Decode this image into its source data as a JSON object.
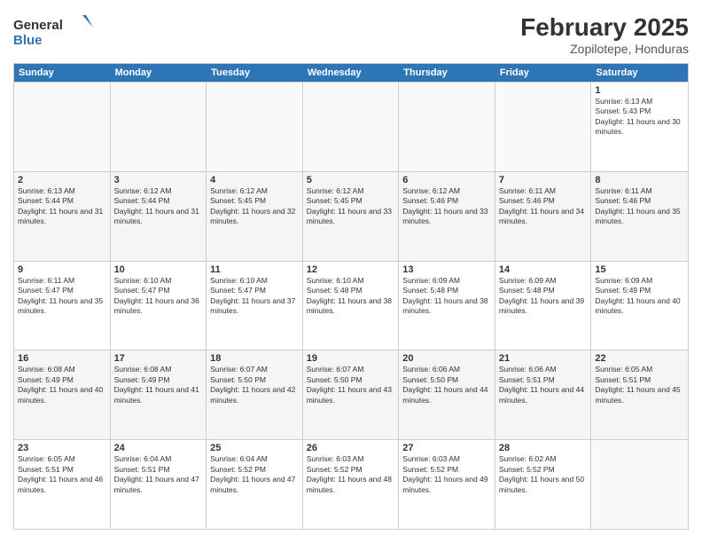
{
  "header": {
    "logo_general": "General",
    "logo_blue": "Blue",
    "month_year": "February 2025",
    "location": "Zopilotepe, Honduras"
  },
  "day_headers": [
    "Sunday",
    "Monday",
    "Tuesday",
    "Wednesday",
    "Thursday",
    "Friday",
    "Saturday"
  ],
  "weeks": [
    {
      "days": [
        {
          "num": "",
          "info": ""
        },
        {
          "num": "",
          "info": ""
        },
        {
          "num": "",
          "info": ""
        },
        {
          "num": "",
          "info": ""
        },
        {
          "num": "",
          "info": ""
        },
        {
          "num": "",
          "info": ""
        },
        {
          "num": "1",
          "info": "Sunrise: 6:13 AM\nSunset: 5:43 PM\nDaylight: 11 hours and 30 minutes."
        }
      ]
    },
    {
      "days": [
        {
          "num": "2",
          "info": "Sunrise: 6:13 AM\nSunset: 5:44 PM\nDaylight: 11 hours and 31 minutes."
        },
        {
          "num": "3",
          "info": "Sunrise: 6:12 AM\nSunset: 5:44 PM\nDaylight: 11 hours and 31 minutes."
        },
        {
          "num": "4",
          "info": "Sunrise: 6:12 AM\nSunset: 5:45 PM\nDaylight: 11 hours and 32 minutes."
        },
        {
          "num": "5",
          "info": "Sunrise: 6:12 AM\nSunset: 5:45 PM\nDaylight: 11 hours and 33 minutes."
        },
        {
          "num": "6",
          "info": "Sunrise: 6:12 AM\nSunset: 5:46 PM\nDaylight: 11 hours and 33 minutes."
        },
        {
          "num": "7",
          "info": "Sunrise: 6:11 AM\nSunset: 5:46 PM\nDaylight: 11 hours and 34 minutes."
        },
        {
          "num": "8",
          "info": "Sunrise: 6:11 AM\nSunset: 5:46 PM\nDaylight: 11 hours and 35 minutes."
        }
      ]
    },
    {
      "days": [
        {
          "num": "9",
          "info": "Sunrise: 6:11 AM\nSunset: 5:47 PM\nDaylight: 11 hours and 35 minutes."
        },
        {
          "num": "10",
          "info": "Sunrise: 6:10 AM\nSunset: 5:47 PM\nDaylight: 11 hours and 36 minutes."
        },
        {
          "num": "11",
          "info": "Sunrise: 6:10 AM\nSunset: 5:47 PM\nDaylight: 11 hours and 37 minutes."
        },
        {
          "num": "12",
          "info": "Sunrise: 6:10 AM\nSunset: 5:48 PM\nDaylight: 11 hours and 38 minutes."
        },
        {
          "num": "13",
          "info": "Sunrise: 6:09 AM\nSunset: 5:48 PM\nDaylight: 11 hours and 38 minutes."
        },
        {
          "num": "14",
          "info": "Sunrise: 6:09 AM\nSunset: 5:48 PM\nDaylight: 11 hours and 39 minutes."
        },
        {
          "num": "15",
          "info": "Sunrise: 6:09 AM\nSunset: 5:49 PM\nDaylight: 11 hours and 40 minutes."
        }
      ]
    },
    {
      "days": [
        {
          "num": "16",
          "info": "Sunrise: 6:08 AM\nSunset: 5:49 PM\nDaylight: 11 hours and 40 minutes."
        },
        {
          "num": "17",
          "info": "Sunrise: 6:08 AM\nSunset: 5:49 PM\nDaylight: 11 hours and 41 minutes."
        },
        {
          "num": "18",
          "info": "Sunrise: 6:07 AM\nSunset: 5:50 PM\nDaylight: 11 hours and 42 minutes."
        },
        {
          "num": "19",
          "info": "Sunrise: 6:07 AM\nSunset: 5:50 PM\nDaylight: 11 hours and 43 minutes."
        },
        {
          "num": "20",
          "info": "Sunrise: 6:06 AM\nSunset: 5:50 PM\nDaylight: 11 hours and 44 minutes."
        },
        {
          "num": "21",
          "info": "Sunrise: 6:06 AM\nSunset: 5:51 PM\nDaylight: 11 hours and 44 minutes."
        },
        {
          "num": "22",
          "info": "Sunrise: 6:05 AM\nSunset: 5:51 PM\nDaylight: 11 hours and 45 minutes."
        }
      ]
    },
    {
      "days": [
        {
          "num": "23",
          "info": "Sunrise: 6:05 AM\nSunset: 5:51 PM\nDaylight: 11 hours and 46 minutes."
        },
        {
          "num": "24",
          "info": "Sunrise: 6:04 AM\nSunset: 5:51 PM\nDaylight: 11 hours and 47 minutes."
        },
        {
          "num": "25",
          "info": "Sunrise: 6:04 AM\nSunset: 5:52 PM\nDaylight: 11 hours and 47 minutes."
        },
        {
          "num": "26",
          "info": "Sunrise: 6:03 AM\nSunset: 5:52 PM\nDaylight: 11 hours and 48 minutes."
        },
        {
          "num": "27",
          "info": "Sunrise: 6:03 AM\nSunset: 5:52 PM\nDaylight: 11 hours and 49 minutes."
        },
        {
          "num": "28",
          "info": "Sunrise: 6:02 AM\nSunset: 5:52 PM\nDaylight: 11 hours and 50 minutes."
        },
        {
          "num": "",
          "info": ""
        }
      ]
    }
  ]
}
